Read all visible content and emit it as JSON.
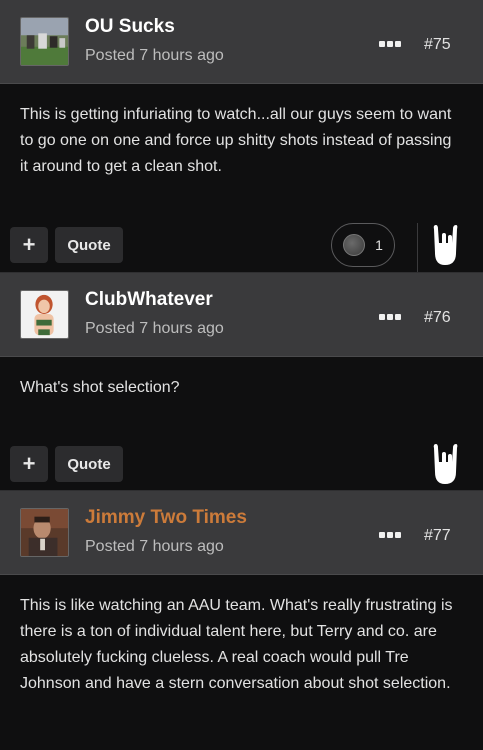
{
  "posts": [
    {
      "author": "OU Sucks",
      "posted": "Posted 7 hours ago",
      "number": "#75",
      "body": "This is getting infuriating to watch...all our guys seem to want to go one on one and force up shitty shots instead of passing it around to get a clean shot.",
      "quote_label": "Quote",
      "add_label": "+",
      "reaction_count": "1"
    },
    {
      "author": "ClubWhatever",
      "posted": "Posted 7 hours ago",
      "number": "#76",
      "body": "What's shot selection?",
      "quote_label": "Quote",
      "add_label": "+"
    },
    {
      "author": "Jimmy Two Times",
      "posted": "Posted 7 hours ago",
      "number": "#77",
      "body": "This is like watching an AAU team. What's really frustrating is there is a ton of individual talent here, but Terry and co. are absolutely fucking clueless. A real coach would pull Tre Johnson and have a stern conversation about shot selection."
    }
  ],
  "icons": {
    "more": "more-dots-icon",
    "react": "rock-on-hand-icon",
    "reaction": "basketball-icon"
  },
  "colors": {
    "header_bg": "#3a3a3c",
    "page_bg": "#0f0f10",
    "accent_author": "#cc7b3a"
  }
}
